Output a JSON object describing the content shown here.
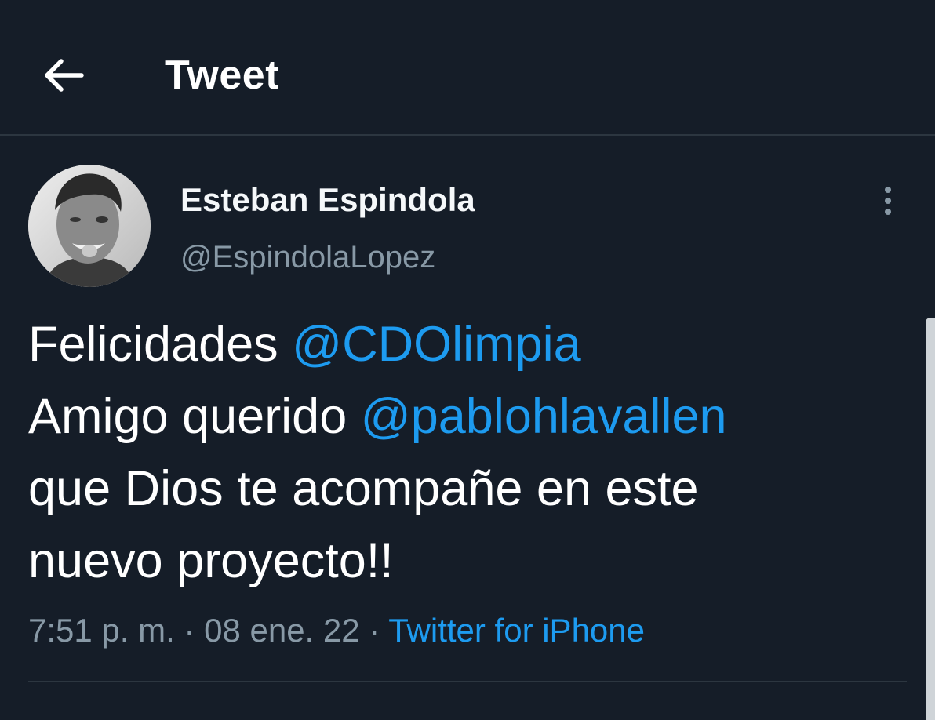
{
  "header": {
    "back_icon": "arrow-left-icon",
    "title": "Tweet"
  },
  "author": {
    "name": "Esteban Espindola",
    "handle": "@EspindolaLopez",
    "avatar_icon": "user-avatar"
  },
  "more_icon": "more-vertical-icon",
  "tweet": {
    "line1_text": "Felicidades ",
    "line1_mention": "@CDOlimpia",
    "line2_text": "Amigo querido ",
    "line2_mention": "@pablohlavallen",
    "line3": "que Dios te acompañe en este",
    "line4": "nuevo proyecto!!"
  },
  "meta": {
    "time": "7:51 p. m.",
    "date": "08 ene. 22",
    "separator": " · ",
    "source": "Twitter for iPhone"
  },
  "colors": {
    "background": "#151d28",
    "mention": "#1d9bf0",
    "secondary_text": "#8899a6",
    "divider": "#2c3640"
  }
}
